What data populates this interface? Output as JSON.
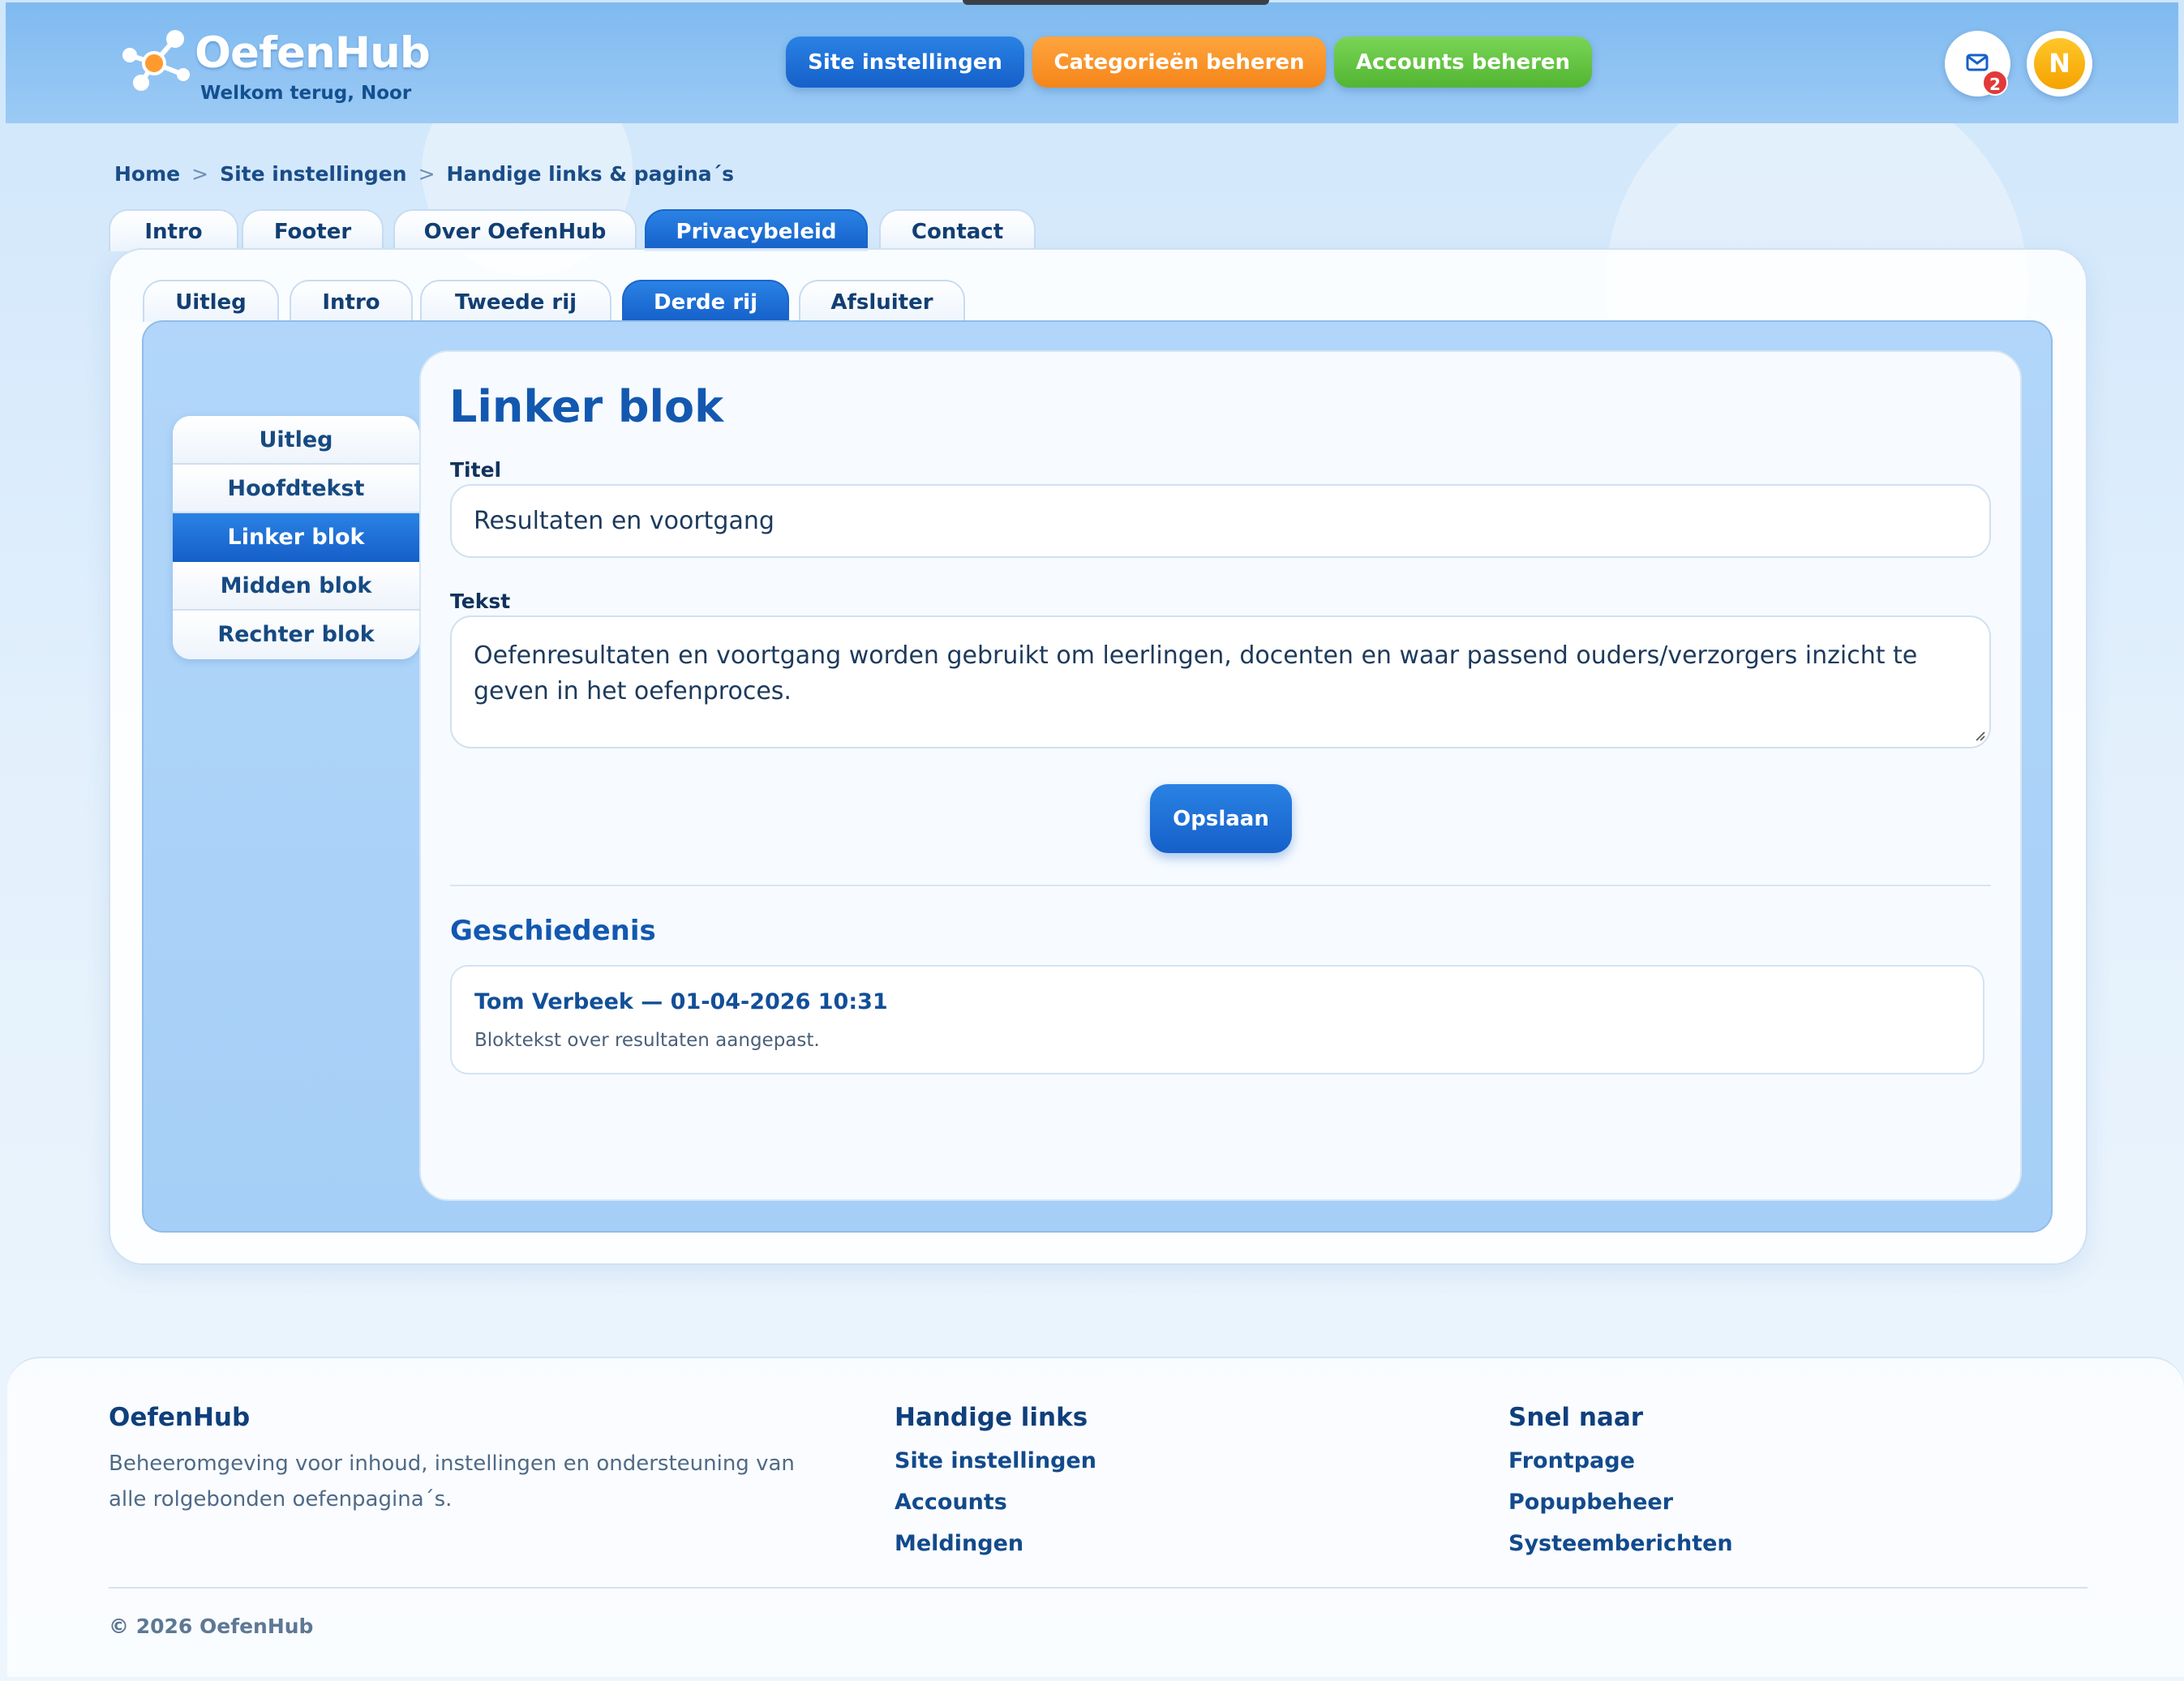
{
  "header": {
    "logo_text": "OefenHub",
    "welcome": "Welkom terug, Noor",
    "buttons": {
      "site_settings": "Site instellingen",
      "categories": "Categorieën beheren",
      "accounts": "Accounts beheren"
    },
    "mail_badge": "2",
    "avatar_initial": "N"
  },
  "breadcrumb": {
    "home": "Home",
    "sep": ">",
    "site_settings": "Site instellingen",
    "current": "Handige links & pagina´s"
  },
  "top_tabs": [
    "Intro",
    "Footer",
    "Over OefenHub",
    "Privacybeleid",
    "Contact"
  ],
  "sub_tabs": [
    "Uitleg",
    "Intro",
    "Tweede rij",
    "Derde rij",
    "Afsluiter"
  ],
  "side_menu": [
    "Uitleg",
    "Hoofdtekst",
    "Linker blok",
    "Midden blok",
    "Rechter blok"
  ],
  "editor": {
    "title": "Linker blok",
    "title_label": "Titel",
    "title_value": "Resultaten en voortgang",
    "text_label": "Tekst",
    "text_value": "Oefenresultaten en voortgang worden gebruikt om leerlingen, docenten en waar passend ouders/verzorgers inzicht te geven in het oefenproces.",
    "save_label": "Opslaan"
  },
  "history": {
    "title": "Geschiedenis",
    "items": [
      {
        "heading": "Tom Verbeek — 01-04-2026 10:31",
        "text": "Bloktekst over resultaten aangepast."
      }
    ]
  },
  "footer": {
    "col1": {
      "title": "OefenHub",
      "desc": "Beheeromgeving voor inhoud, instellingen en ondersteuning van alle rolgebonden oefenpagina´s."
    },
    "col2": {
      "title": "Handige links",
      "links": [
        "Site instellingen",
        "Accounts",
        "Meldingen"
      ]
    },
    "col3": {
      "title": "Snel naar",
      "links": [
        "Frontpage",
        "Popupbeheer",
        "Systeemberichten"
      ]
    },
    "copyright": "© 2026 OefenHub"
  },
  "icons": {
    "logo": "molecule-logo-icon",
    "mail": "mail-icon",
    "resize": "resize-grip-icon"
  },
  "colors": {
    "primary": "#1560c9",
    "orange": "#f5851a",
    "green": "#52b632",
    "badge": "#e23a3a",
    "avatar": "#f4a300"
  }
}
